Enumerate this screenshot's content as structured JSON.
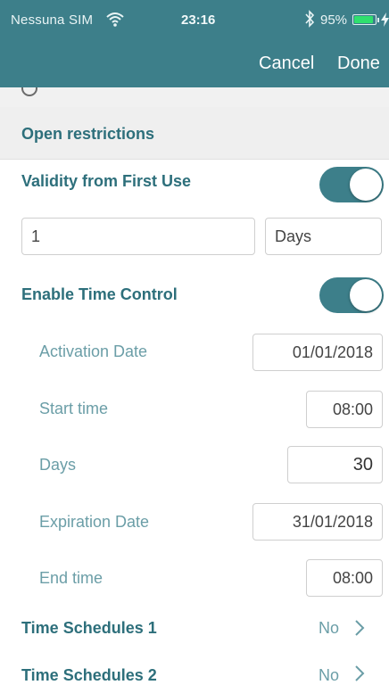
{
  "status_bar": {
    "carrier": "Nessuna SIM",
    "time": "23:16",
    "battery_percent": "95%",
    "battery_level": 0.95,
    "icons": [
      "wifi-icon",
      "bluetooth-icon",
      "battery-icon",
      "charging-bolt-icon"
    ]
  },
  "nav": {
    "cancel_label": "Cancel",
    "done_label": "Done"
  },
  "section": {
    "title": "Open restrictions"
  },
  "validity": {
    "label": "Validity from First Use",
    "enabled": true,
    "amount": "1",
    "unit": "Days"
  },
  "time_control": {
    "label": "Enable Time Control",
    "enabled": true,
    "activation_date_label": "Activation Date",
    "activation_date": "01/01/2018",
    "start_time_label": "Start time",
    "start_time": "08:00",
    "days_label": "Days",
    "days": "30",
    "expiration_date_label": "Expiration Date",
    "expiration_date": "31/01/2018",
    "end_time_label": "End time",
    "end_time": "08:00"
  },
  "schedules": [
    {
      "label": "Time Schedules 1",
      "value": "No"
    },
    {
      "label": "Time Schedules 2",
      "value": "No"
    }
  ],
  "colors": {
    "accent": "#3d7f8a",
    "label_bold": "#2d6f7b",
    "label_light": "#6b9ea7",
    "battery_green": "#2fe06e"
  }
}
